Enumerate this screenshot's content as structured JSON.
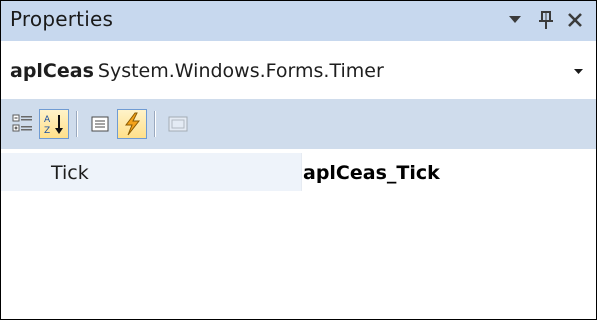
{
  "window": {
    "title": "Properties",
    "buttons": {
      "dropdown_icon": "triangle-down-icon",
      "pin_icon": "pin-icon",
      "close_icon": "close-icon"
    }
  },
  "selector": {
    "object_name": "aplCeas",
    "object_type": "System.Windows.Forms.Timer"
  },
  "toolbar": {
    "items": [
      {
        "icon": "categorized-icon",
        "checked": false
      },
      {
        "icon": "alphabetical-icon",
        "checked": true
      },
      {
        "icon": "properties-icon",
        "checked": false
      },
      {
        "icon": "events-icon",
        "checked": true
      },
      {
        "icon": "property-pages-icon",
        "checked": false,
        "disabled": true
      }
    ]
  },
  "grid": {
    "rows": [
      {
        "name": "Tick",
        "value": "aplCeas_Tick"
      }
    ]
  },
  "colors": {
    "titlebar": "#c7d8ee",
    "toolbar": "#cfdcec",
    "row_background": "#eef3fa",
    "checked_button": "#ffe08a"
  }
}
